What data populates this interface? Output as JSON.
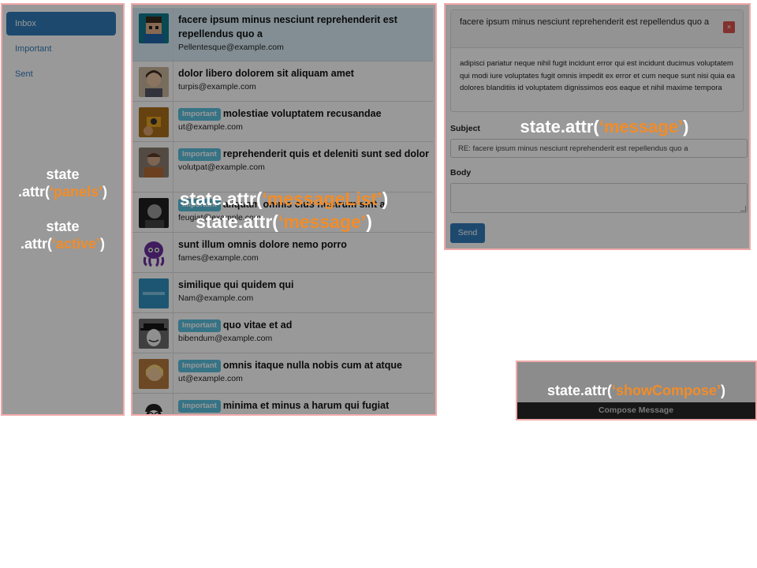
{
  "sidebar": {
    "items": [
      {
        "label": "Inbox",
        "active": true
      },
      {
        "label": "Important",
        "active": false
      },
      {
        "label": "Sent",
        "active": false
      }
    ]
  },
  "message_list": {
    "rows": [
      {
        "subject": "facere ipsum minus nesciunt reprehenderit est repellendus quo a",
        "email": "Pellentesque@example.com",
        "important": false,
        "selected": true,
        "avatar": "pixel-avatar-icon"
      },
      {
        "subject": "dolor libero dolorem sit aliquam amet",
        "email": "turpis@example.com",
        "important": false,
        "avatar": "woman-photo-avatar-icon"
      },
      {
        "subject": "molestiae voluptatem recusandae",
        "email": "ut@example.com",
        "important": true,
        "avatar": "camera-person-avatar-icon"
      },
      {
        "subject": "reprehenderit quis et deleniti sunt sed dolor",
        "email": "volutpat@example.com",
        "important": true,
        "avatar": "man-photo-avatar-icon"
      },
      {
        "subject": "aliquam omnis eius nostrum sint a",
        "email": "feugiat@example.com",
        "important": true,
        "avatar": "bw-man-avatar-icon"
      },
      {
        "subject": "sunt illum omnis dolore nemo porro",
        "email": "fames@example.com",
        "important": false,
        "avatar": "octopus-avatar-icon"
      },
      {
        "subject": "similique qui quidem qui",
        "email": "Nam@example.com",
        "important": false,
        "avatar": "logo-avatar-icon"
      },
      {
        "subject": "quo vitae et ad",
        "email": "bibendum@example.com",
        "important": true,
        "avatar": "mask-avatar-icon"
      },
      {
        "subject": "omnis itaque nulla nobis cum at atque",
        "email": "ut@example.com",
        "important": true,
        "avatar": "blonde-avatar-icon"
      },
      {
        "subject": "minima et minus a harum qui fugiat consequuntur quis",
        "email": "",
        "important": true,
        "avatar": "cartoon-avatar-icon"
      }
    ],
    "badge_label": "Important"
  },
  "message": {
    "subject": "facere ipsum minus nesciunt reprehenderit est repellendus quo a",
    "close_label": "×",
    "body": "adipisci pariatur neque nihil fugit incidunt error qui est incidunt ducimus voluptatem qui modi iure voluptates fugit omnis impedit ex error et cum neque sunt nisi quia ea dolores blanditiis id voluptatem dignissimos eos eaque et nihil maxime tempora"
  },
  "reply_form": {
    "subject_label": "Subject",
    "subject_value": "RE: facere ipsum minus nesciunt reprehenderit est repellendus quo a",
    "body_label": "Body",
    "send_label": "Send"
  },
  "compose": {
    "label": "Compose Message"
  },
  "annotations": {
    "sidebar_line1": "state",
    "sidebar_line2_prefix": ".attr(",
    "sidebar_line2_key": "‘panels’",
    "sidebar_line2_suffix": ")",
    "sidebar_line3": "state",
    "sidebar_line4_prefix": ".attr(",
    "sidebar_line4_key": "‘active’",
    "sidebar_line4_suffix": ")",
    "list_line1_prefix": "state.attr(",
    "list_line1_key": "‘messageList’",
    "list_line1_suffix": ")",
    "list_line2_prefix": "state.attr(",
    "list_line2_key": "‘message’",
    "list_line2_suffix": ")",
    "detail_prefix": "state.attr(",
    "detail_key": "‘message’",
    "detail_suffix": ")",
    "compose_prefix": "state.attr(",
    "compose_key": "‘showCompose’",
    "compose_suffix": ")",
    "highlight_color": "#f28c28",
    "border_color": "#f1a9a9"
  }
}
